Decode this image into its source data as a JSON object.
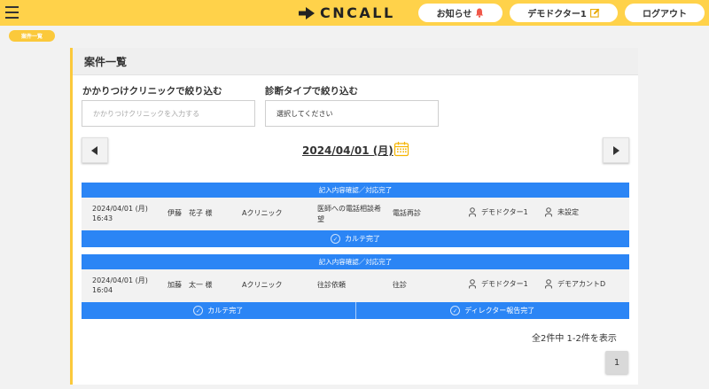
{
  "header": {
    "logo_text": "CNCALL",
    "notifications_label": "お知らせ",
    "user_label": "デモドクター1",
    "logout_label": "ログアウト",
    "accent_color": "#ffd24a",
    "bell_color": "#f0584a"
  },
  "breadcrumb": {
    "label": "案件一覧"
  },
  "page": {
    "title": "案件一覧"
  },
  "filters": {
    "clinic": {
      "label": "かかりつけクリニックで絞り込む",
      "placeholder": "かかりつけクリニックを入力する"
    },
    "diagnosis": {
      "label": "診断タイプで絞り込む",
      "value": "選択してください"
    }
  },
  "date_nav": {
    "date": "2024/04/01 (月)"
  },
  "cases": [
    {
      "status": "記入内容確認／対応完了",
      "date_line1": "2024/04/01 (月)",
      "time": "16:43",
      "patient": "伊藤　花子 様",
      "clinic": "Aクリニック",
      "request_line1": "医師への電話相談希",
      "request_line2": "望",
      "type": "電話再診",
      "doctor": "デモドクター1",
      "director": "未設定",
      "actions": [
        "カルテ完了"
      ]
    },
    {
      "status": "記入内容確認／対応完了",
      "date_line1": "2024/04/01 (月)",
      "time": "16:04",
      "patient": "加藤　太一 様",
      "clinic": "Aクリニック",
      "request_line1": "往診依頼",
      "request_line2": "",
      "type": "往診",
      "doctor": "デモドクター1",
      "director": "デモアカントD",
      "actions": [
        "カルテ完了",
        "ディレクター報告完了"
      ]
    }
  ],
  "pagination": {
    "summary": "全2件中 1-2件を表示",
    "current_page": "1"
  },
  "colors": {
    "status_blue": "#2b85f5",
    "panel_accent": "#fbc93b"
  },
  "icons": [
    "menu-icon",
    "logo-arrow-icon",
    "bell-icon",
    "edit-icon",
    "calendar-icon",
    "chevron-left-icon",
    "chevron-right-icon",
    "doctor-icon",
    "director-icon",
    "check-circle-icon"
  ]
}
